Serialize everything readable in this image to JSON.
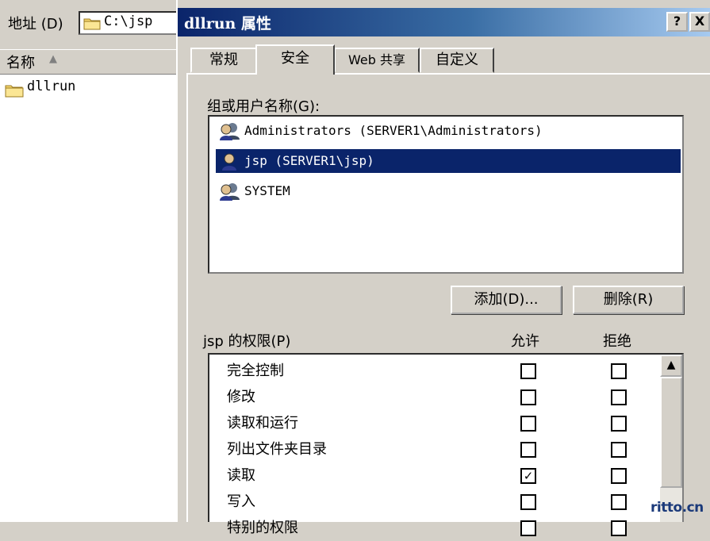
{
  "explorer": {
    "address_label": "地址 (D)",
    "address_value": "C:\\jsp",
    "column_name": "名称",
    "items": [
      {
        "name": "dllrun"
      }
    ]
  },
  "dialog": {
    "title": "dllrun 属性",
    "help_label": "?",
    "close_label": "X",
    "tabs": [
      "常规",
      "安全",
      "Web 共享",
      "自定义"
    ],
    "active_tab": "安全",
    "users_label": "组或用户名称(G):",
    "users": [
      {
        "name": "Administrators (SERVER1\\Administrators)",
        "selected": false
      },
      {
        "name": "jsp (SERVER1\\jsp)",
        "selected": true
      },
      {
        "name": "SYSTEM",
        "selected": false
      }
    ],
    "add_label": "添加(D)...",
    "remove_label": "删除(R)",
    "permissions_label": "jsp 的权限(P)",
    "allow_header": "允许",
    "deny_header": "拒绝",
    "permissions": [
      {
        "name": "完全控制",
        "allow": false,
        "deny": false
      },
      {
        "name": "修改",
        "allow": false,
        "deny": false
      },
      {
        "name": "读取和运行",
        "allow": false,
        "deny": false
      },
      {
        "name": "列出文件夹目录",
        "allow": false,
        "deny": false
      },
      {
        "name": "读取",
        "allow": true,
        "deny": false
      },
      {
        "name": "写入",
        "allow": false,
        "deny": false
      },
      {
        "name": "特别的权限",
        "allow": false,
        "deny": false
      }
    ]
  },
  "watermark": "ritto.cn",
  "colors": {
    "selection": "#0a246a",
    "titlebar": "#0a246a",
    "face": "#d4d0c8"
  }
}
